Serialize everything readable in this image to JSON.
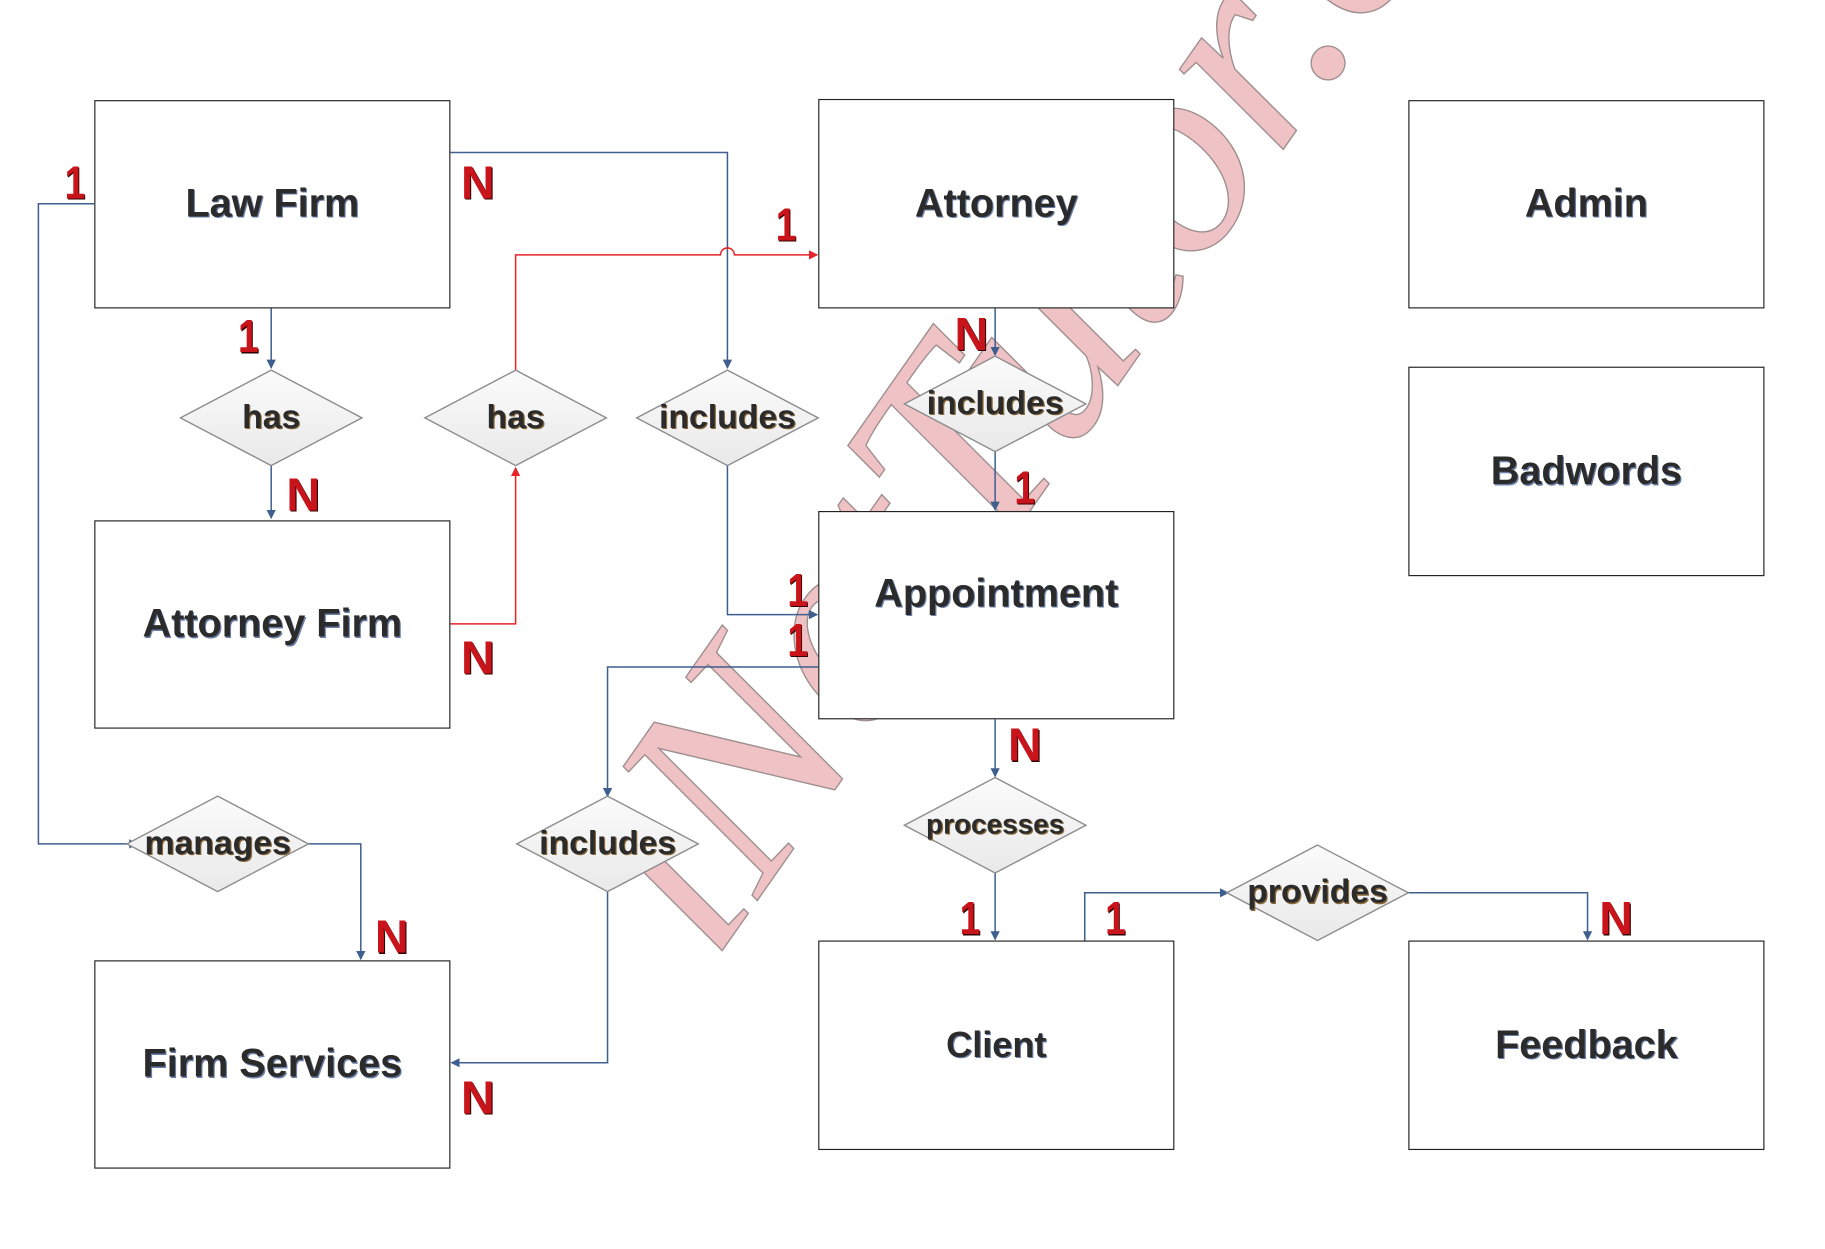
{
  "diagram": {
    "type": "ER diagram",
    "watermark": "iNetTutor.com",
    "colors": {
      "entity_border": "#222222",
      "connector_blue": "#3f5f8f",
      "connector_red": "#e8232a",
      "cardinality": "#c8141a",
      "diamond_fill": "#f2f2f2",
      "diamond_border": "#8c8c8c"
    },
    "entities": {
      "law_firm": "Law Firm",
      "attorney": "Attorney",
      "admin": "Admin",
      "badwords": "Badwords",
      "attorney_firm": "Attorney Firm",
      "appointment": "Appointment",
      "firm_services": "Firm Services",
      "client": "Client",
      "feedback": "Feedback"
    },
    "relationships": {
      "lawfirm_has_attorneyfirm": "has",
      "attorneyfirm_has_attorney": "has",
      "lawfirm_includes_appointment": "includes",
      "attorney_includes_appointment": "includes",
      "lawfirm_manages_services": "manages",
      "appointment_includes_services": "includes",
      "appointment_processes_client": "processes",
      "client_provides_feedback": "provides"
    },
    "cardinalities": {
      "lawfirm_left": "1",
      "lawfirm_right": "N",
      "lawfirm_bottom": "1",
      "attorneyfirm_top": "N",
      "attorneyfirm_right": "N",
      "attorney_left": "1",
      "attorney_bottom": "N",
      "appointment_top": "1",
      "appointment_left_upper": "1",
      "appointment_left_lower": "1",
      "appointment_bottom": "N",
      "firmservices_top": "N",
      "firmservices_right": "N",
      "client_top_left": "1",
      "client_top_right": "1",
      "feedback_top": "N"
    }
  }
}
